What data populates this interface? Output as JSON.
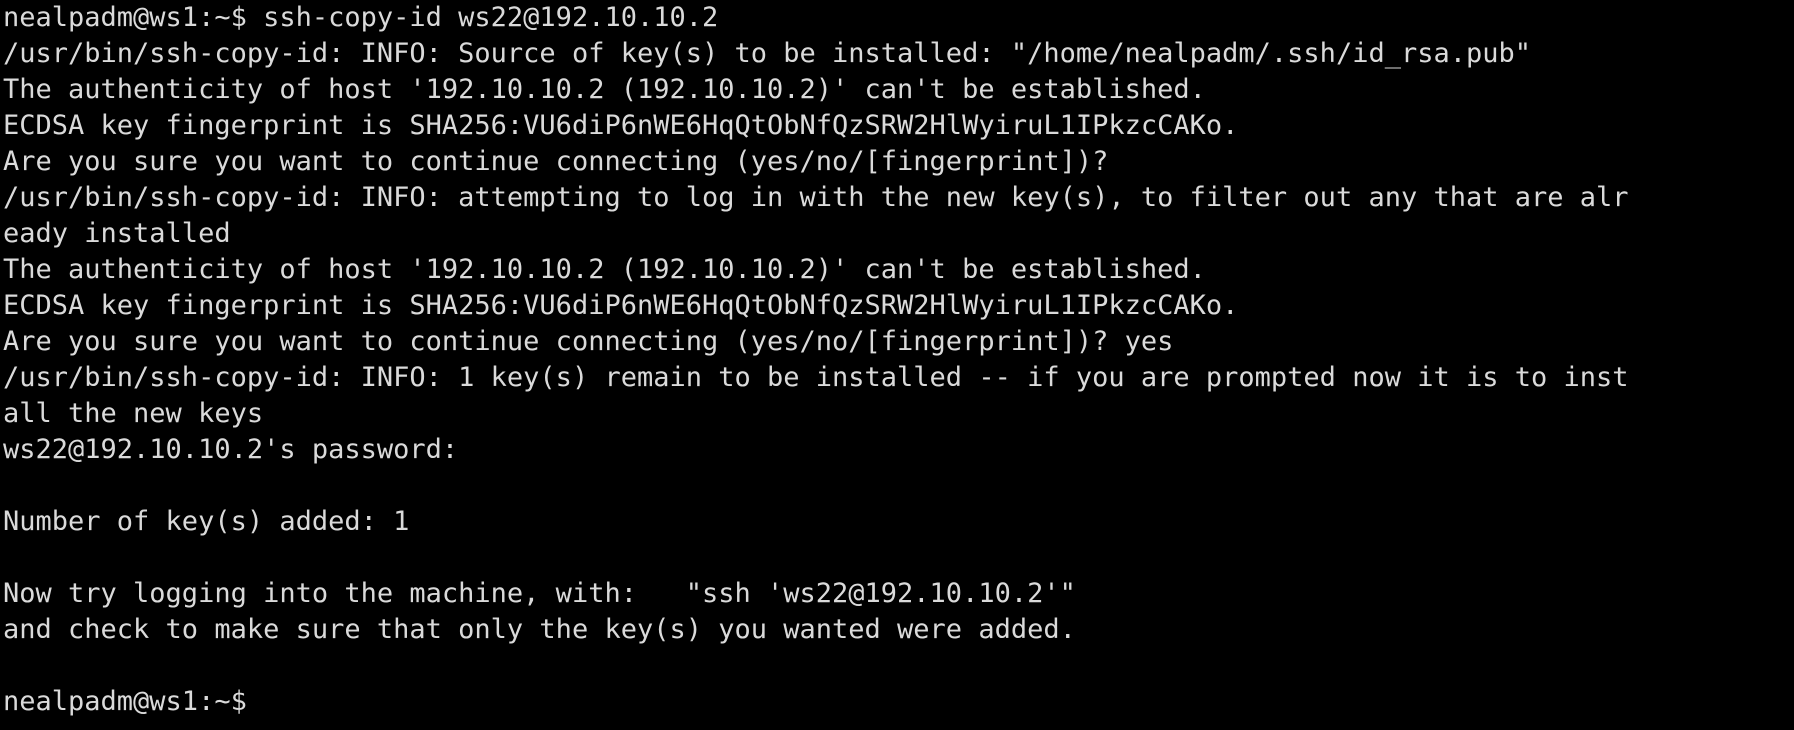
{
  "terminal": {
    "background": "#000000",
    "foreground": "#dadada",
    "lines": [
      "nealpadm@ws1:~$ ssh-copy-id ws22@192.10.10.2",
      "/usr/bin/ssh-copy-id: INFO: Source of key(s) to be installed: \"/home/nealpadm/.ssh/id_rsa.pub\"",
      "The authenticity of host '192.10.10.2 (192.10.10.2)' can't be established.",
      "ECDSA key fingerprint is SHA256:VU6diP6nWE6HqQtObNfQzSRW2HlWyiruL1IPkzcCAKo.",
      "Are you sure you want to continue connecting (yes/no/[fingerprint])?",
      "/usr/bin/ssh-copy-id: INFO: attempting to log in with the new key(s), to filter out any that are alr",
      "eady installed",
      "The authenticity of host '192.10.10.2 (192.10.10.2)' can't be established.",
      "ECDSA key fingerprint is SHA256:VU6diP6nWE6HqQtObNfQzSRW2HlWyiruL1IPkzcCAKo.",
      "Are you sure you want to continue connecting (yes/no/[fingerprint])? yes",
      "/usr/bin/ssh-copy-id: INFO: 1 key(s) remain to be installed -- if you are prompted now it is to inst",
      "all the new keys",
      "ws22@192.10.10.2's password:",
      "",
      "Number of key(s) added: 1",
      "",
      "Now try logging into the machine, with:   \"ssh 'ws22@192.10.10.2'\"",
      "and check to make sure that only the key(s) you wanted were added.",
      "",
      "nealpadm@ws1:~$"
    ]
  }
}
